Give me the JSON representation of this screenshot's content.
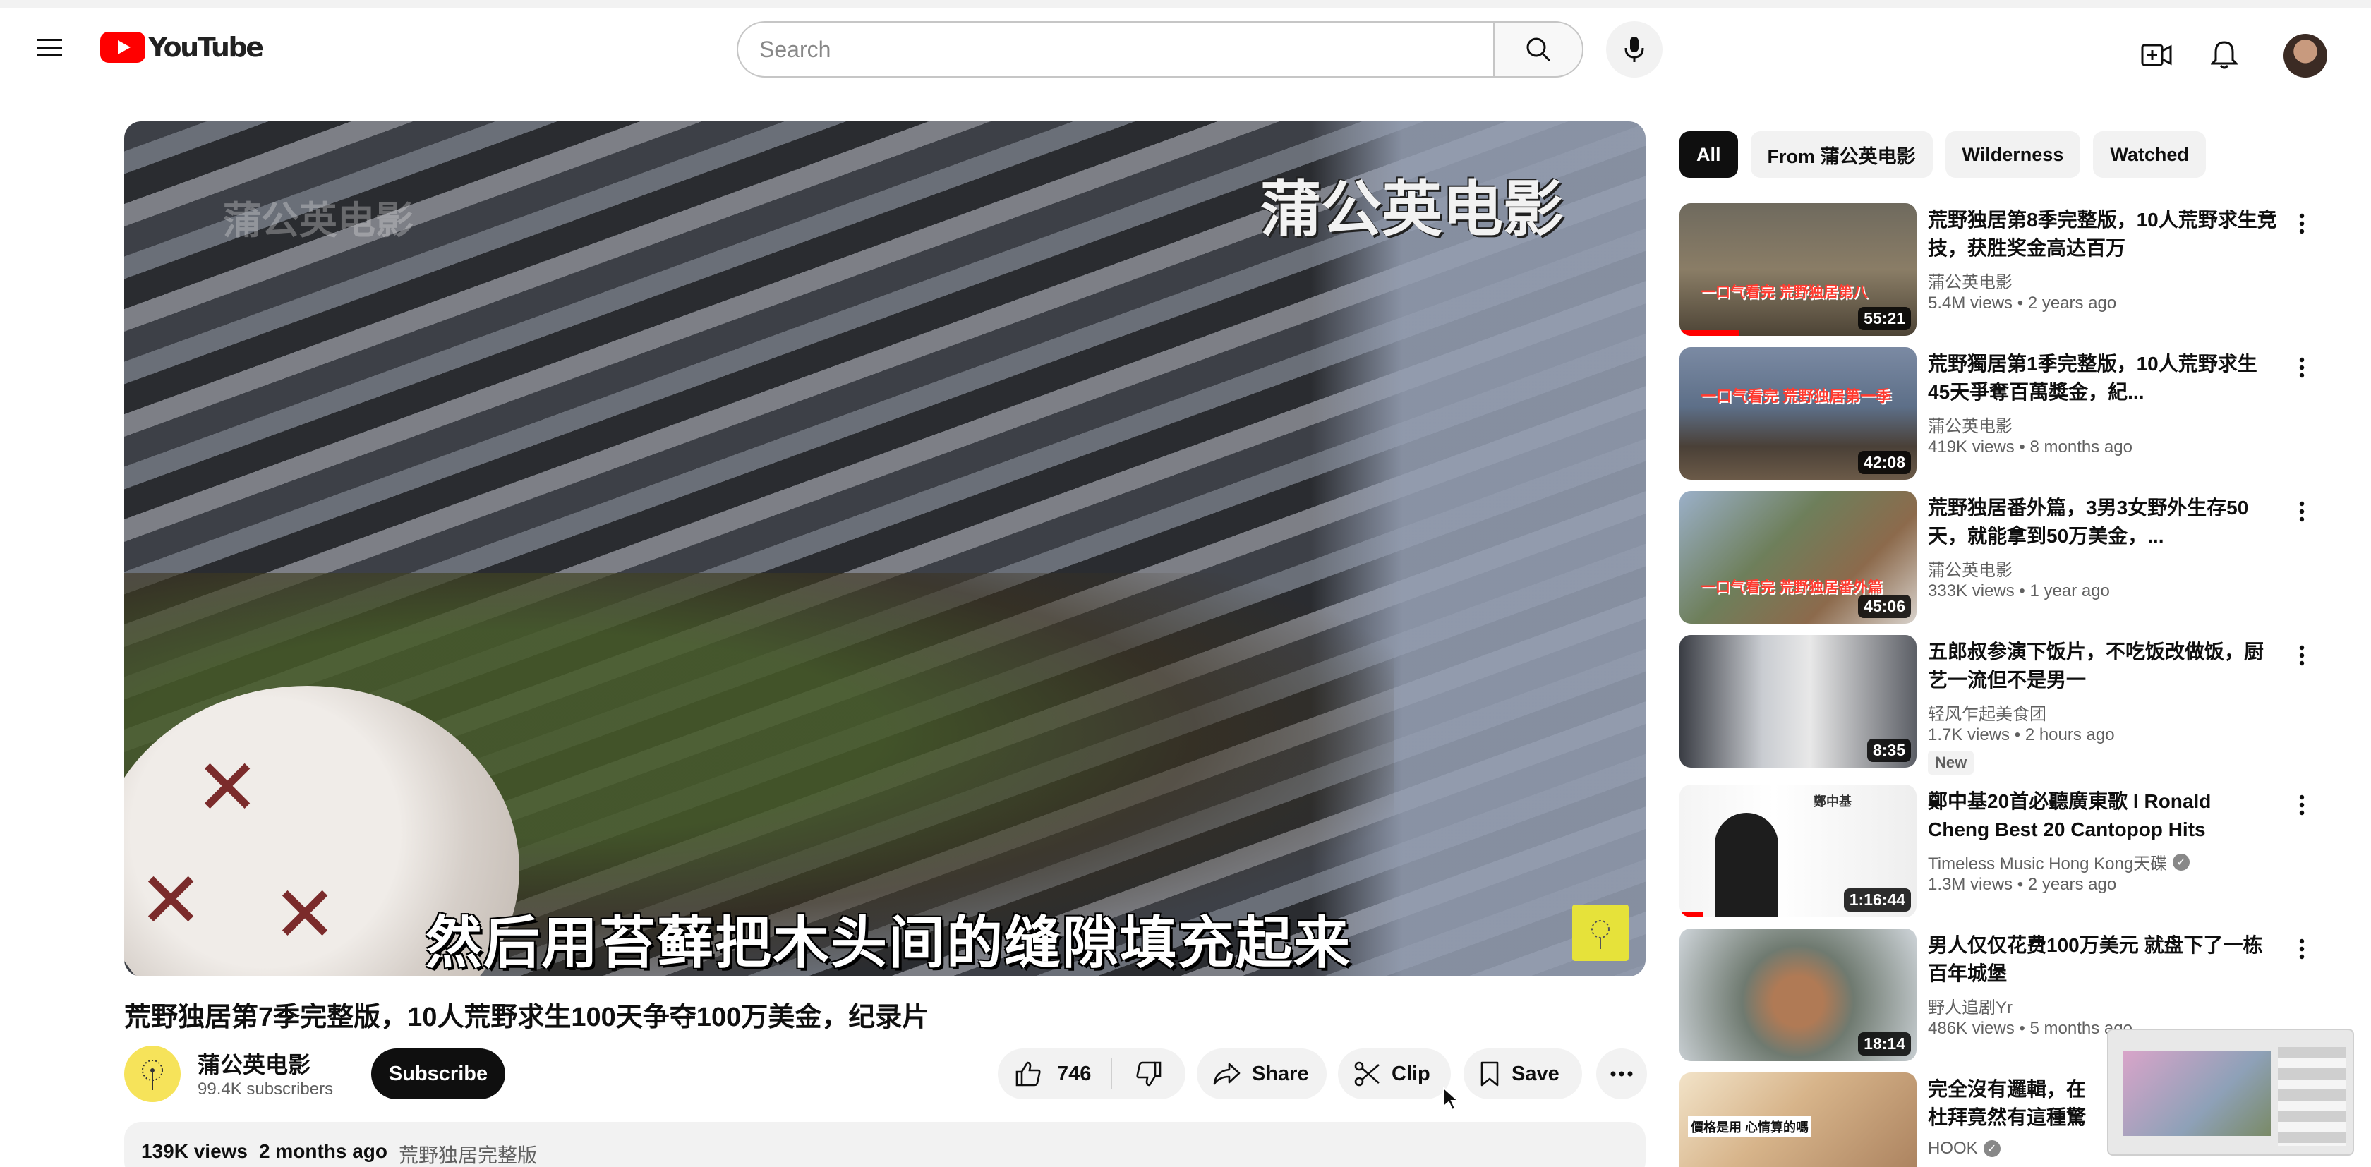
{
  "header": {
    "logo_text": "YouTube",
    "search_placeholder": "Search"
  },
  "video": {
    "watermark_left": "蒲公英电影",
    "watermark_right": "蒲公英电影",
    "subtitle": "然后用苔藓把木头间的缝隙填充起来",
    "title": "荒野独居第7季完整版，10人荒野求生100天争夺100万美金，纪录片",
    "channel_name": "蒲公英电影",
    "subscribers": "99.4K subscribers",
    "subscribe_label": "Subscribe",
    "like_count": "746",
    "share_label": "Share",
    "clip_label": "Clip",
    "save_label": "Save",
    "views": "139K views",
    "age": "2 months ago",
    "tag": "荒野独居完整版"
  },
  "chips": [
    "All",
    "From 蒲公英电影",
    "Wilderness",
    "Watched"
  ],
  "recommendations": [
    {
      "title": "荒野独居第8季完整版，10人荒野求生竞技，获胜奖金高达百万",
      "channel": "蒲公英电影",
      "views": "5.4M views",
      "age": "2 years ago",
      "duration": "55:21",
      "thumb_caption": "一口气看完 荒野独居第八",
      "verified": false,
      "new": false,
      "progress": 0.25
    },
    {
      "title": "荒野獨居第1季完整版，10人荒野求生45天爭奪百萬獎金，紀...",
      "channel": "蒲公英电影",
      "views": "419K views",
      "age": "8 months ago",
      "duration": "42:08",
      "thumb_caption": "一口气看完 荒野独居第一季",
      "verified": false,
      "new": false,
      "progress": 0
    },
    {
      "title": "荒野独居番外篇，3男3女野外生存50天，就能拿到50万美金，...",
      "channel": "蒲公英电影",
      "views": "333K views",
      "age": "1 year ago",
      "duration": "45:06",
      "thumb_caption": "一口气看完 荒野独居番外篇",
      "verified": false,
      "new": false,
      "progress": 0
    },
    {
      "title": "五郎叔参演下饭片，不吃饭改做饭，厨艺一流但不是男一",
      "channel": "轻风乍起美食团",
      "views": "1.7K views",
      "age": "2 hours ago",
      "duration": "8:35",
      "thumb_caption": "",
      "verified": false,
      "new": true,
      "new_label": "New",
      "progress": 0
    },
    {
      "title": "鄭中基20首必聽廣東歌 I Ronald Cheng Best 20 Cantopop Hits",
      "channel": "Timeless Music Hong Kong天碟",
      "views": "1.3M views",
      "age": "2 years ago",
      "duration": "1:16:44",
      "thumb_caption": "鄭中基",
      "verified": true,
      "new": false,
      "progress": 0.1
    },
    {
      "title": "男人仅仅花费100万美元 就盘下了一栋百年城堡",
      "channel": "野人追剧Yr",
      "views": "486K views",
      "age": "5 months ago",
      "duration": "18:14",
      "thumb_caption": "",
      "verified": false,
      "new": false,
      "progress": 0
    },
    {
      "title": "完全沒有邏輯，在杜拜竟然有這種驚喜包😍【價值觀錯...",
      "channel": "HOOK",
      "views": "",
      "age": "",
      "duration": "",
      "thumb_caption": "價格是用 心情算的嗎",
      "verified": true,
      "new": false,
      "progress": 0
    }
  ],
  "colors": {
    "brand_red": "#ff0000",
    "text_primary": "#0f0f0f",
    "text_secondary": "#606060",
    "chip_bg": "#f2f2f2"
  },
  "icons": [
    "hamburger-menu-icon",
    "youtube-logo-icon",
    "search-icon",
    "mic-icon",
    "create-icon",
    "bell-icon",
    "thumbs-up-icon",
    "thumbs-down-icon",
    "share-icon",
    "scissors-icon",
    "bookmark-icon",
    "more-horizontal-icon",
    "more-vertical-icon",
    "verified-icon"
  ]
}
